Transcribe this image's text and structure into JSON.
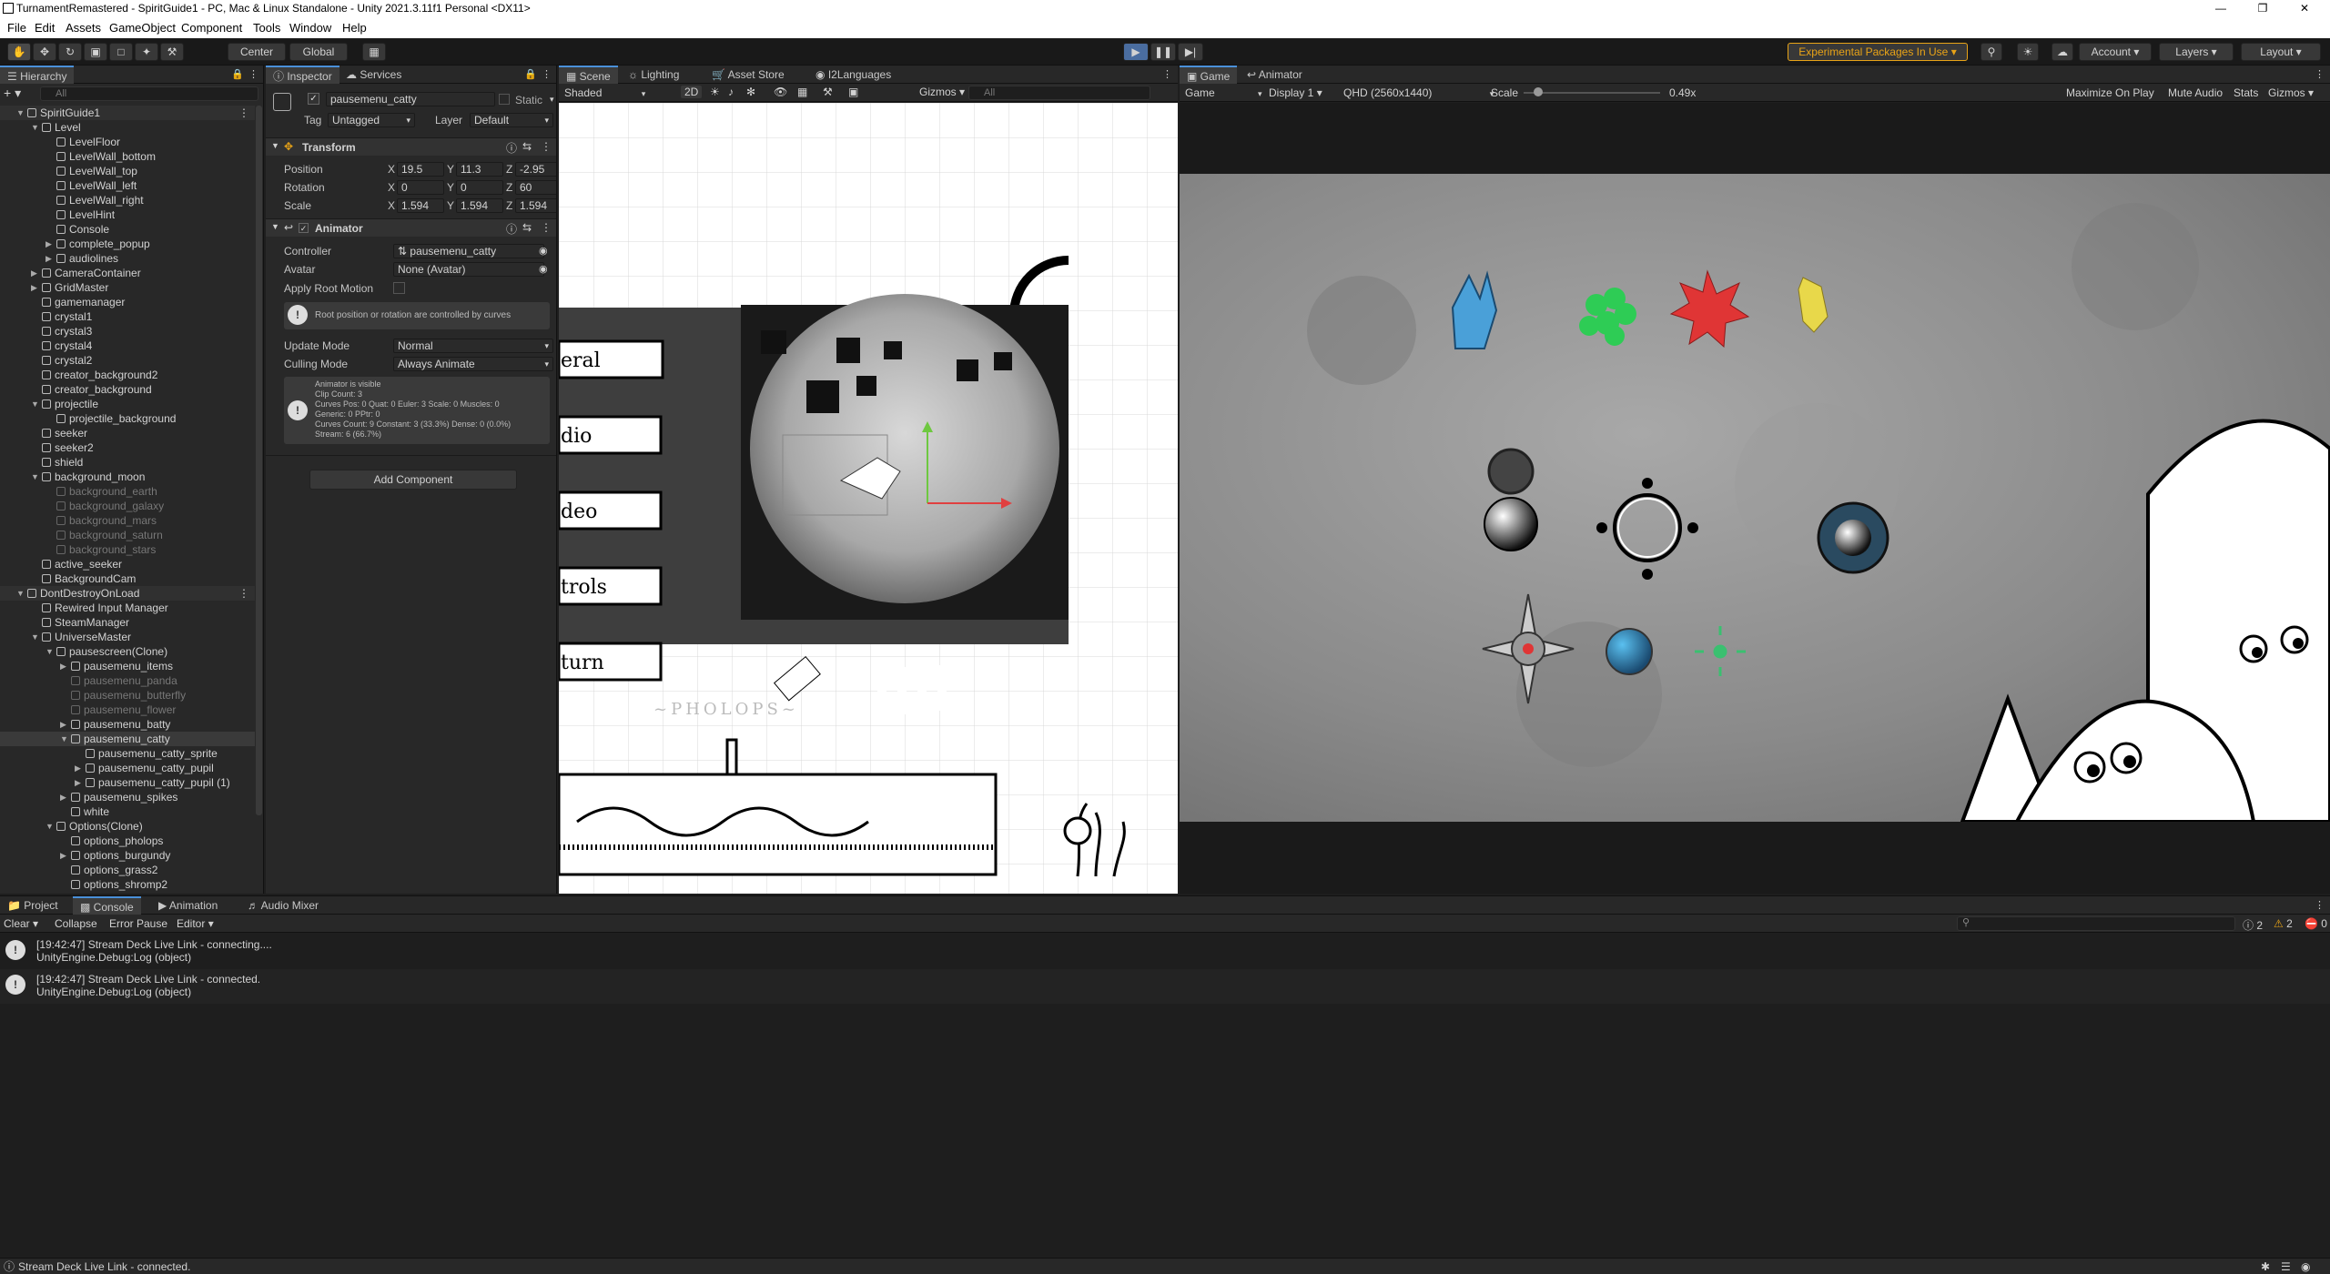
{
  "window": {
    "title": "TurnamentRemastered - SpiritGuide1 - PC, Mac & Linux Standalone - Unity 2021.3.11f1 Personal <DX11>"
  },
  "menu": [
    "File",
    "Edit",
    "Assets",
    "GameObject",
    "Component",
    "Tools",
    "Window",
    "Help"
  ],
  "toolbar": {
    "center": "Center",
    "global": "Global",
    "experimental": "Experimental Packages In Use",
    "account": "Account",
    "layers": "Layers",
    "layout": "Layout"
  },
  "hierarchy": {
    "tab": "Hierarchy",
    "search_placeholder": "All",
    "rows": [
      {
        "label": "SpiritGuide1",
        "depth": 0,
        "arrow": "▼",
        "type": "scene"
      },
      {
        "label": "Level",
        "depth": 1,
        "arrow": "▼"
      },
      {
        "label": "LevelFloor",
        "depth": 2
      },
      {
        "label": "LevelWall_bottom",
        "depth": 2
      },
      {
        "label": "LevelWall_top",
        "depth": 2
      },
      {
        "label": "LevelWall_left",
        "depth": 2
      },
      {
        "label": "LevelWall_right",
        "depth": 2
      },
      {
        "label": "LevelHint",
        "depth": 2
      },
      {
        "label": "Console",
        "depth": 2
      },
      {
        "label": "complete_popup",
        "depth": 2,
        "arrow": "▶"
      },
      {
        "label": "audiolines",
        "depth": 2,
        "arrow": "▶"
      },
      {
        "label": "CameraContainer",
        "depth": 1,
        "arrow": "▶"
      },
      {
        "label": "GridMaster",
        "depth": 1,
        "arrow": "▶"
      },
      {
        "label": "gamemanager",
        "depth": 1
      },
      {
        "label": "crystal1",
        "depth": 1
      },
      {
        "label": "crystal3",
        "depth": 1
      },
      {
        "label": "crystal4",
        "depth": 1
      },
      {
        "label": "crystal2",
        "depth": 1
      },
      {
        "label": "creator_background2",
        "depth": 1
      },
      {
        "label": "creator_background",
        "depth": 1
      },
      {
        "label": "projectile",
        "depth": 1,
        "arrow": "▼"
      },
      {
        "label": "projectile_background",
        "depth": 2
      },
      {
        "label": "seeker",
        "depth": 1
      },
      {
        "label": "seeker2",
        "depth": 1
      },
      {
        "label": "shield",
        "depth": 1
      },
      {
        "label": "background_moon",
        "depth": 1,
        "arrow": "▼"
      },
      {
        "label": "background_earth",
        "depth": 2,
        "dim": true
      },
      {
        "label": "background_galaxy",
        "depth": 2,
        "dim": true
      },
      {
        "label": "background_mars",
        "depth": 2,
        "dim": true
      },
      {
        "label": "background_saturn",
        "depth": 2,
        "dim": true
      },
      {
        "label": "background_stars",
        "depth": 2,
        "dim": true
      },
      {
        "label": "active_seeker",
        "depth": 1
      },
      {
        "label": "BackgroundCam",
        "depth": 1
      },
      {
        "label": "DontDestroyOnLoad",
        "depth": 0,
        "arrow": "▼",
        "type": "scene"
      },
      {
        "label": "Rewired Input Manager",
        "depth": 1
      },
      {
        "label": "SteamManager",
        "depth": 1
      },
      {
        "label": "UniverseMaster",
        "depth": 1,
        "arrow": "▼"
      },
      {
        "label": "pausescreen(Clone)",
        "depth": 2,
        "arrow": "▼"
      },
      {
        "label": "pausemenu_items",
        "depth": 3,
        "arrow": "▶"
      },
      {
        "label": "pausemenu_panda",
        "depth": 3,
        "dim": true
      },
      {
        "label": "pausemenu_butterfly",
        "depth": 3,
        "dim": true
      },
      {
        "label": "pausemenu_flower",
        "depth": 3,
        "dim": true
      },
      {
        "label": "pausemenu_batty",
        "depth": 3,
        "arrow": "▶"
      },
      {
        "label": "pausemenu_catty",
        "depth": 3,
        "arrow": "▼",
        "sel": true
      },
      {
        "label": "pausemenu_catty_sprite",
        "depth": 4
      },
      {
        "label": "pausemenu_catty_pupil",
        "depth": 4,
        "arrow": "▶"
      },
      {
        "label": "pausemenu_catty_pupil (1)",
        "depth": 4,
        "arrow": "▶"
      },
      {
        "label": "pausemenu_spikes",
        "depth": 3,
        "arrow": "▶"
      },
      {
        "label": "white",
        "depth": 3
      },
      {
        "label": "Options(Clone)",
        "depth": 2,
        "arrow": "▼"
      },
      {
        "label": "options_pholops",
        "depth": 3
      },
      {
        "label": "options_burgundy",
        "depth": 3,
        "arrow": "▶"
      },
      {
        "label": "options_grass2",
        "depth": 3
      },
      {
        "label": "options_shromp2",
        "depth": 3
      }
    ]
  },
  "inspector": {
    "tab": "Inspector",
    "tab2": "Services",
    "object_name": "pausemenu_catty",
    "static": "Static",
    "tag_label": "Tag",
    "tag": "Untagged",
    "layer_label": "Layer",
    "layer": "Default",
    "transform": {
      "title": "Transform",
      "position_label": "Position",
      "pos": [
        "19.5",
        "11.3",
        "-2.95"
      ],
      "rotation_label": "Rotation",
      "rot": [
        "0",
        "0",
        "60"
      ],
      "scale_label": "Scale",
      "scl": [
        "1.594",
        "1.594",
        "1.594"
      ]
    },
    "animator": {
      "title": "Animator",
      "controller_label": "Controller",
      "controller": "pausemenu_catty",
      "avatar_label": "Avatar",
      "avatar": "None (Avatar)",
      "root_motion_label": "Apply Root Motion",
      "root_motion_info": "Root position or rotation are controlled by curves",
      "update_mode_label": "Update Mode",
      "update_mode": "Normal",
      "culling_mode_label": "Culling Mode",
      "culling_mode": "Always Animate",
      "info_lines": [
        "Animator is visible",
        "Clip Count: 3",
        "Curves Pos: 0 Quat: 0 Euler: 3 Scale: 0 Muscles: 0",
        "Generic: 0 PPtr: 0",
        "Curves Count: 9 Constant: 3 (33.3%) Dense: 0 (0.0%)",
        "Stream: 6 (66.7%)"
      ]
    },
    "add_component": "Add Component"
  },
  "scene": {
    "tabs": [
      "Scene",
      "Lighting",
      "Asset Store",
      "I2Languages"
    ],
    "shading": "Shaded",
    "mode2d": "2D",
    "gizmos": "Gizmos",
    "search": "All",
    "menu_items": [
      "eral",
      "dio",
      "deo",
      "trols",
      "turn"
    ],
    "signature": "~PHOLOPS~"
  },
  "game": {
    "tabs": [
      "Game",
      "Animator"
    ],
    "display_mode": "Game",
    "display": "Display 1",
    "resolution": "QHD (2560x1440)",
    "scale_label": "Scale",
    "scale_value": "0.49x",
    "scale_fraction": 0.49,
    "maximize": "Maximize On Play",
    "mute": "Mute Audio",
    "stats": "Stats",
    "gizmos": "Gizmos"
  },
  "console": {
    "tabs": [
      "Project",
      "Console",
      "Animation",
      "Audio Mixer"
    ],
    "toolbar": [
      "Clear",
      "Collapse",
      "Error Pause",
      "Editor"
    ],
    "counts": {
      "info": "2",
      "warn": "2",
      "error": "0"
    },
    "entries": [
      {
        "line1": "[19:42:47] Stream Deck Live Link - connecting....",
        "line2": "UnityEngine.Debug:Log (object)"
      },
      {
        "line1": "[19:42:47] Stream Deck Live Link - connected.",
        "line2": "UnityEngine.Debug:Log (object)"
      }
    ]
  },
  "status": {
    "message": "Stream Deck Live Link - connected."
  },
  "colors": {
    "accent": "#4a90d9",
    "experimental": "#e8a317",
    "crystal_blue": "#4aa0d8",
    "crystal_green": "#2ecc55",
    "crystal_red": "#e03535",
    "crystal_yellow": "#e8d84a"
  }
}
